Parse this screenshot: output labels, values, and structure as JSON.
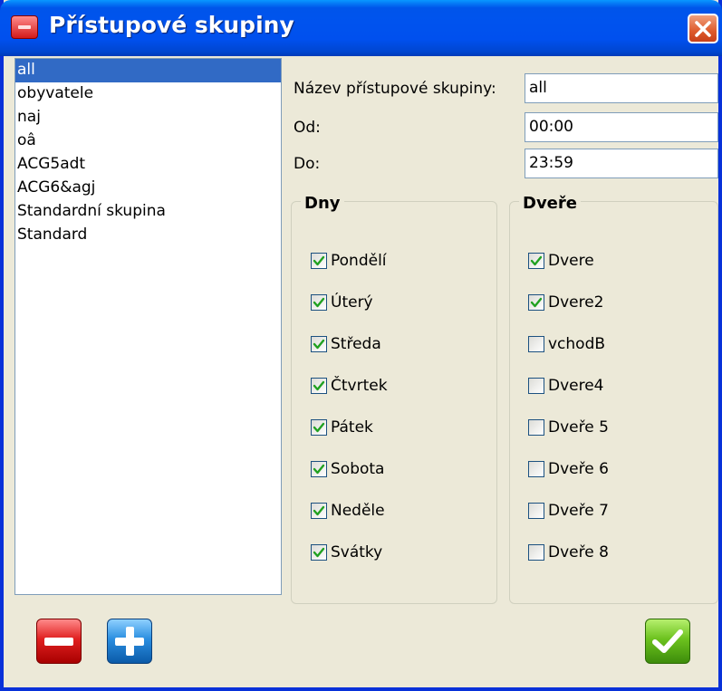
{
  "window": {
    "title": "Přístupové skupiny",
    "title_icon": "app-icon",
    "close_icon": "close-icon"
  },
  "groups": {
    "selected_index": 0,
    "items": [
      "all",
      "obyvatele",
      "naj",
      "oâ",
      "ACG5adt",
      "ACG6&agj",
      "Standardní skupina",
      "Standard"
    ]
  },
  "form": {
    "name_label": "Název přístupové skupiny:",
    "name_value": "all",
    "from_label": "Od:",
    "from_value": "00:00",
    "to_label": "Do:",
    "to_value": "23:59"
  },
  "days": {
    "title": "Dny",
    "items": [
      {
        "label": "Pondělí",
        "checked": true
      },
      {
        "label": "Úterý",
        "checked": true
      },
      {
        "label": "Středa",
        "checked": true
      },
      {
        "label": "Čtvrtek",
        "checked": true
      },
      {
        "label": "Pátek",
        "checked": true
      },
      {
        "label": "Sobota",
        "checked": true
      },
      {
        "label": "Neděle",
        "checked": true
      },
      {
        "label": "Svátky",
        "checked": true
      }
    ]
  },
  "doors": {
    "title": "Dveře",
    "items": [
      {
        "label": "Dvere",
        "checked": true
      },
      {
        "label": "Dvere2",
        "checked": true
      },
      {
        "label": "vchodB",
        "checked": false
      },
      {
        "label": "Dvere4",
        "checked": false
      },
      {
        "label": "Dveře 5",
        "checked": false
      },
      {
        "label": "Dveře 6",
        "checked": false
      },
      {
        "label": "Dveře 7",
        "checked": false
      },
      {
        "label": "Dveře 8",
        "checked": false
      }
    ]
  },
  "toolbar": {
    "delete_icon": "minus-icon",
    "add_icon": "plus-icon",
    "confirm_icon": "check-icon"
  },
  "colors": {
    "titlebar": "#0054e3",
    "selection": "#316ac5",
    "window_bg": "#ece9d8",
    "check_mark": "#21a121"
  }
}
